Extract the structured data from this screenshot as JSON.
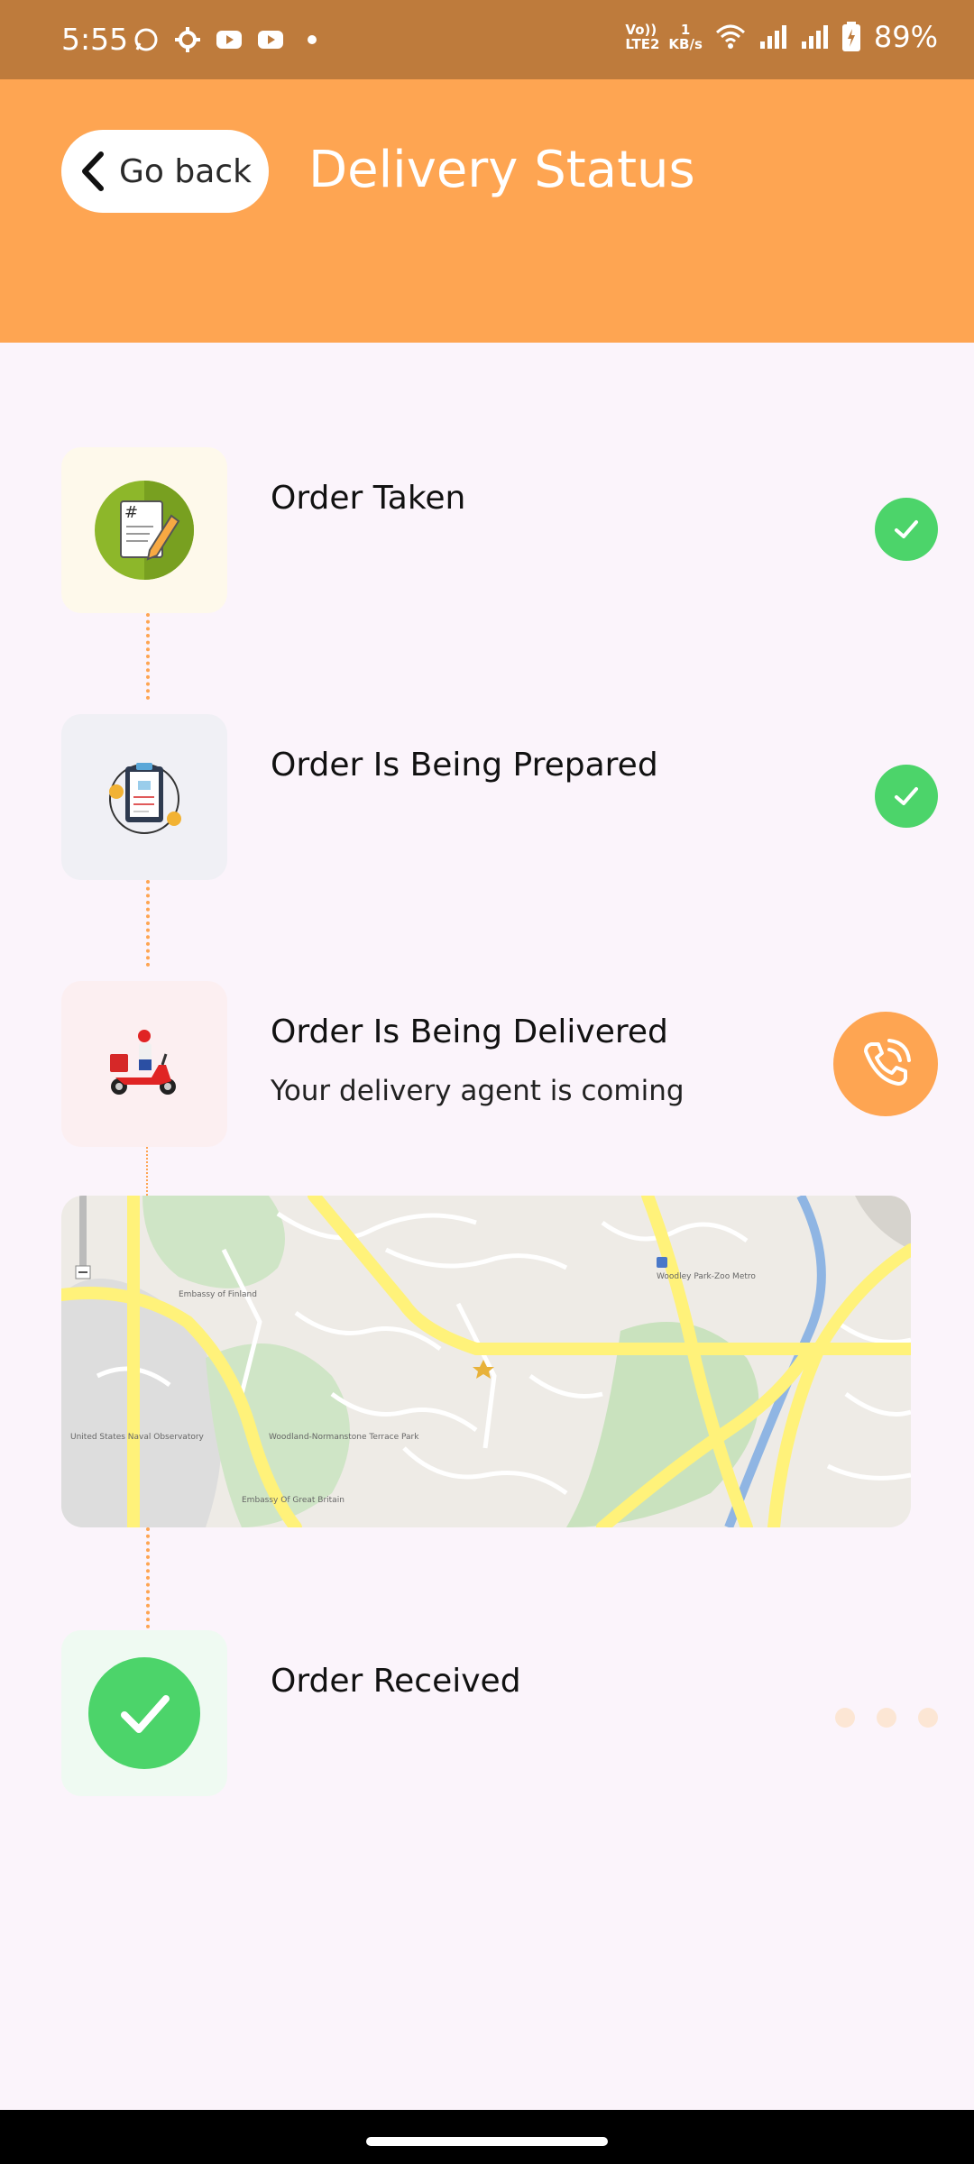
{
  "status_bar": {
    "time": "5:55",
    "network_top": "1",
    "network_bottom": "KB/s",
    "volte": "Vo)) LTE2",
    "battery": "89%"
  },
  "header": {
    "back_label": "Go back",
    "title": "Delivery Status"
  },
  "steps": [
    {
      "title": "Order Taken",
      "status": "done",
      "icon": "notepad-icon"
    },
    {
      "title": "Order Is Being Prepared",
      "status": "done",
      "icon": "clipboard-icon"
    },
    {
      "title": "Order Is Being Delivered",
      "subtitle": "Your delivery agent is coming",
      "status": "active",
      "icon": "scooter-icon"
    },
    {
      "title": "Order Received",
      "status": "pending",
      "icon": "check-icon"
    }
  ],
  "map": {
    "labels": {
      "embassy_finland": "Embassy of Finland",
      "woodley": "Woodley Park-Zoo Metro",
      "us_naval": "United States Naval Observatory",
      "woodland": "Woodland-Normanstone Terrace Park",
      "embassy_gb": "Embassy Of Great Britain"
    }
  },
  "colors": {
    "accent": "#FEA552",
    "status_bar": "#BE7B3C",
    "done_green": "#4CD46A",
    "background": "#FBF4FB"
  }
}
